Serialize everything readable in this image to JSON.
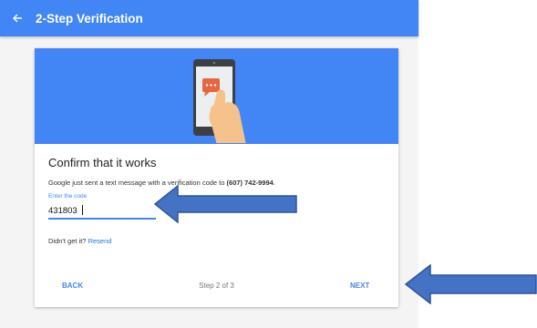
{
  "header": {
    "title": "2-Step Verification",
    "back_icon": "arrow-left-icon"
  },
  "card": {
    "illustration_icon": "phone-text-message-icon",
    "title": "Confirm that it works",
    "description_prefix": "Google just sent a text message with a verification code to ",
    "phone_number": "(607) 742-9994",
    "description_suffix": ".",
    "code_field": {
      "label": "Enter the code",
      "value": "431803"
    },
    "resend_prompt": "Didn't get it?",
    "resend_link": "Resend"
  },
  "footer": {
    "back_label": "BACK",
    "step_text": "Step 2 of 3",
    "next_label": "NEXT"
  },
  "colors": {
    "brand_blue": "#4285f4",
    "annotation_blue": "#4472c4"
  }
}
